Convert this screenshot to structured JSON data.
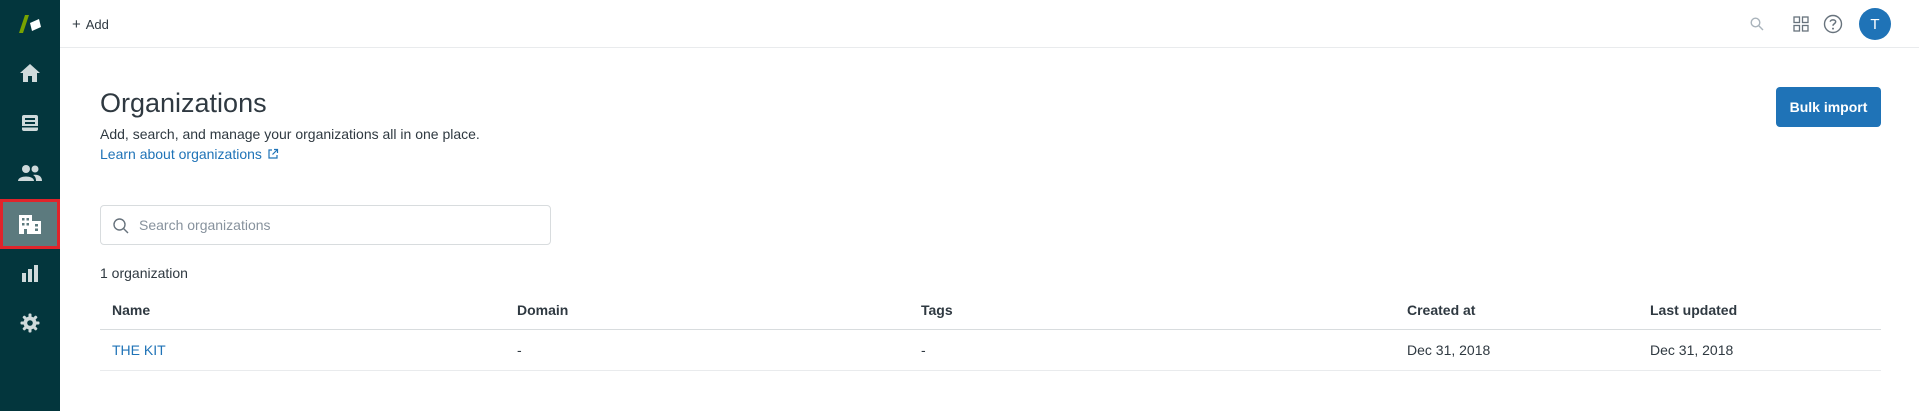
{
  "sidebar": {
    "items": [
      {
        "name": "home",
        "icon": "home-icon"
      },
      {
        "name": "views",
        "icon": "inbox-icon"
      },
      {
        "name": "customers",
        "icon": "users-icon"
      },
      {
        "name": "organizations",
        "icon": "building-icon",
        "active": true
      },
      {
        "name": "reporting",
        "icon": "bar-chart-icon"
      },
      {
        "name": "admin",
        "icon": "gear-icon"
      }
    ],
    "brand_color": "#03363d",
    "logo_color": "#78a300"
  },
  "topbar": {
    "add_label": "Add",
    "avatar_initial": "T",
    "icons": [
      "search-icon",
      "apps-grid-icon",
      "help-icon"
    ]
  },
  "page": {
    "title": "Organizations",
    "subtitle": "Add, search, and manage your organizations all in one place.",
    "learn_link": "Learn about organizations",
    "bulk_import": "Bulk import"
  },
  "search": {
    "placeholder": "Search organizations",
    "value": ""
  },
  "results": {
    "count_label": "1 organization"
  },
  "table": {
    "columns": [
      "Name",
      "Domain",
      "Tags",
      "Created at",
      "Last updated"
    ],
    "rows": [
      {
        "name": "THE KIT",
        "domain": "-",
        "tags": "-",
        "created_at": "Dec 31, 2018",
        "last_updated": "Dec 31, 2018"
      }
    ]
  },
  "colors": {
    "accent": "#1f73b7",
    "active_highlight": "#e0242b"
  }
}
